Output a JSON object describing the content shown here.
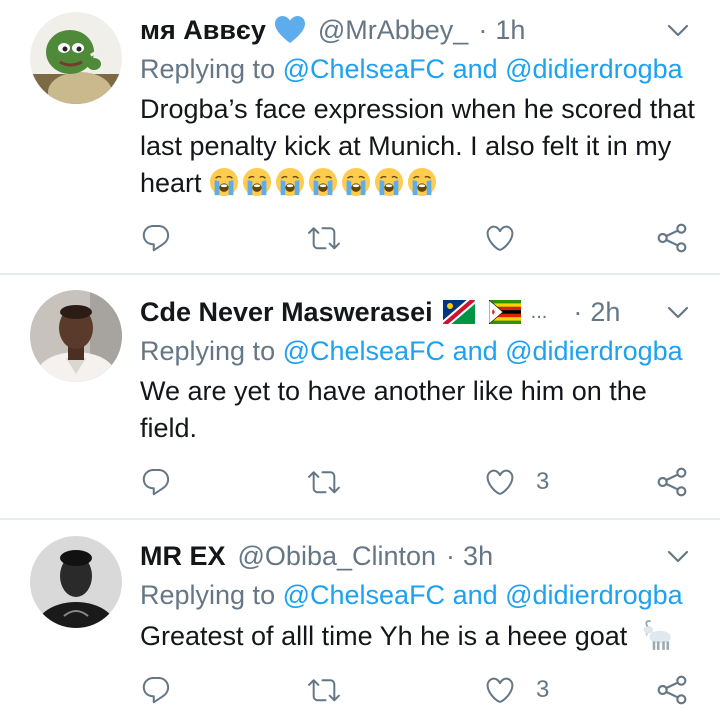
{
  "tweets": [
    {
      "name": "мя Аввєу",
      "handle": "@MrAbbey_",
      "dot": "·",
      "time": "1h",
      "replying_prefix": "Replying to ",
      "mention_1": "@ChelseaFC",
      "and_word": " and ",
      "mention_2": "@didierdrogba",
      "text": "Drogba’s face expression when he scored that last penalty kick at Munich. I also felt it in my heart",
      "emoji": "crying-face-emoji",
      "emoji_count": 7,
      "verified_heart": "blue-heart-emoji",
      "like_count": ""
    },
    {
      "name": "Cde Never Maswerasei",
      "flags": [
        "namibia-flag-emoji",
        "zimbabwe-flag-emoji"
      ],
      "ellipsis": "...",
      "dot": "·",
      "time": "2h",
      "replying_prefix": "Replying to ",
      "mention_1": "@ChelseaFC",
      "and_word": " and ",
      "mention_2": "@didierdrogba",
      "text": "We are yet to have another like him on the field.",
      "like_count": "3"
    },
    {
      "name": "MR EX",
      "handle": "@Obiba_Clinton",
      "dot": "·",
      "time": "3h",
      "replying_prefix": "Replying to ",
      "mention_1": "@ChelseaFC",
      "and_word": " and ",
      "mention_2": "@didierdrogba",
      "text": "Greatest of alll time Yh he is a heee goat",
      "emoji": "goat-emoji",
      "like_count": "3"
    }
  ],
  "colors": {
    "link": "#1da1f2",
    "secondary": "#657786",
    "divider": "#e6ecf0",
    "text": "#14171a"
  },
  "icons": [
    "reply-icon",
    "retweet-icon",
    "like-icon",
    "share-icon",
    "caret-down-icon"
  ]
}
